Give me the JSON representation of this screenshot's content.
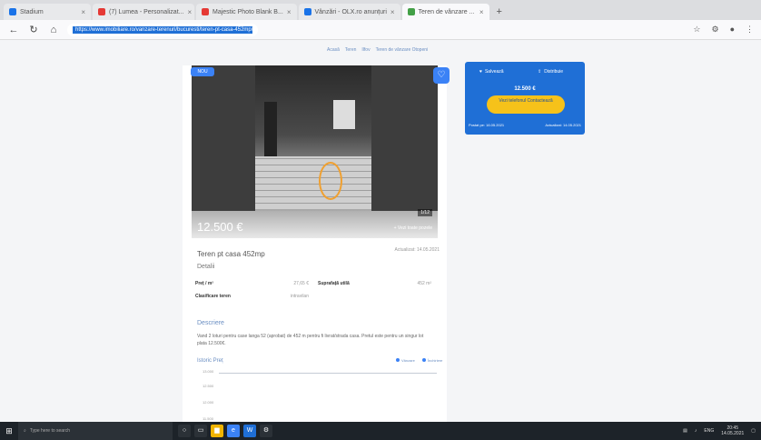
{
  "browser": {
    "tabs": [
      {
        "label": "Stadium",
        "fav": "blue",
        "active": false
      },
      {
        "label": "(7) Lumea - Personalizat...",
        "fav": "red",
        "active": false
      },
      {
        "label": "Majestic Photo Blank B...",
        "fav": "red",
        "active": false
      },
      {
        "label": "Vânzări - OLX.ro anunțuri",
        "fav": "blue",
        "active": false
      },
      {
        "label": "Teren de vânzare ...",
        "fav": "green",
        "active": true
      }
    ],
    "new_tab": "+",
    "url": "https://www.imobiliare.ro/vanzare-terenuri/bucuresti/teren-pt-casa-452mp/X6AZ58"
  },
  "page": {
    "breadcrumb": [
      "Acasă",
      "Teren",
      "Ilfov",
      "Teren de vânzare Otopeni"
    ],
    "listing": {
      "badge": "NOU",
      "price_overlay": "12.500 €",
      "photo_counter": "1/12",
      "more_images": "+ Vezi toate pozele",
      "title": "Teren pt casa 452mp",
      "subtitle": "Detalii",
      "posted": "Actualizat: 14.05.2021",
      "specs": [
        [
          {
            "label": "Preț / m²",
            "value": "27,65 €"
          },
          {
            "label": "Suprafață utilă",
            "value": "452 m²"
          }
        ],
        [
          {
            "label": "Clasificare teren",
            "value": "intravilan"
          }
        ]
      ],
      "section_title": "Descriere",
      "description": "Vand 2 loturi pentru case langa 52 (aprobat) de 452 m pentru fi livrat/strada casa. Pretul este pentru un singur lot plata 12.500€.",
      "history_title": "Istoric Preț",
      "legend": [
        "Vânzare",
        "Închiriere"
      ],
      "y_ticks": [
        "13.000",
        "12.500",
        "12.000",
        "11.500"
      ]
    },
    "sidebar": {
      "favorite": "Salvează",
      "share": "Distribuie",
      "price": "12.500 €",
      "cta": "Vezi telefonul Contactează",
      "meta_left": "Postat pe: 16.05.2021",
      "meta_right": "Actualizat: 14.05.2021"
    }
  },
  "taskbar": {
    "search_placeholder": "Type here to search",
    "time": "20:45",
    "date": "14.05.2021",
    "lang": "ENG"
  }
}
